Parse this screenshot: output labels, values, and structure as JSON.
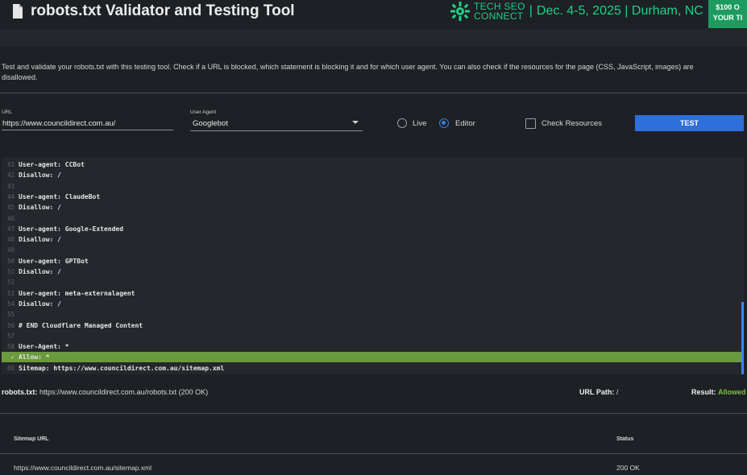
{
  "header": {
    "title": "robots.txt Validator and Testing Tool",
    "banner_brand_line1": "TECH SEO",
    "banner_brand_line2": "CONNECT",
    "banner_separator": "|",
    "banner_event": "Dec. 4-5, 2025 | Durham, NC",
    "promo_line1": "$100 O",
    "promo_line2": "YOUR TI"
  },
  "intro": "Test and validate your robots.txt with this testing tool. Check if a URL is blocked, which statement is blocking it and for which user agent. You can also check if the resources for the page (CSS, JavaScript, images) are disallowed.",
  "form": {
    "url_label": "URL",
    "url_value": "https://www.councildirect.com.au/",
    "ua_label": "User Agent",
    "ua_value": "Googlebot",
    "radio_live": "Live",
    "radio_editor": "Editor",
    "selected_mode": "Editor",
    "check_resources": "Check Resources",
    "check_resources_checked": false,
    "test_button": "TEST"
  },
  "editor": {
    "lines": [
      {
        "n": "41",
        "text": "User-agent: CCBot"
      },
      {
        "n": "42",
        "text": "Disallow: /"
      },
      {
        "n": "43",
        "text": ""
      },
      {
        "n": "44",
        "text": "User-agent: ClaudeBot"
      },
      {
        "n": "45",
        "text": "Disallow: /"
      },
      {
        "n": "46",
        "text": ""
      },
      {
        "n": "47",
        "text": "User-agent: Google-Extended"
      },
      {
        "n": "48",
        "text": "Disallow: /"
      },
      {
        "n": "49",
        "text": ""
      },
      {
        "n": "50",
        "text": "User-agent: GPTBot"
      },
      {
        "n": "51",
        "text": "Disallow: /"
      },
      {
        "n": "52",
        "text": ""
      },
      {
        "n": "53",
        "text": "User-agent: meta-externalagent"
      },
      {
        "n": "54",
        "text": "Disallow: /"
      },
      {
        "n": "55",
        "text": ""
      },
      {
        "n": "56",
        "text": "# END Cloudflare Managed Content"
      },
      {
        "n": "57",
        "text": ""
      },
      {
        "n": "58",
        "text": "User-Agent: *"
      },
      {
        "n": "✓",
        "text": "Allow: *"
      },
      {
        "n": "60",
        "text": "Sitemap: https://www.councildirect.com.au/sitemap.xml"
      }
    ],
    "highlighted_line": "Allow: *",
    "highlight_color": "#6b9a3e"
  },
  "result": {
    "robots_label": "robots.txt:",
    "robots_value": "https://www.councildirect.com.au/robots.txt (200 OK)",
    "url_path_label": "URL Path:",
    "url_path_value": "/",
    "result_label": "Result:",
    "result_value": "Allowed",
    "result_color": "#7bc143"
  },
  "sitemaps": {
    "col_url": "Sitemap URL",
    "col_status": "Status",
    "rows": [
      {
        "url": "https://www.councildirect.com.au/sitemap.xml",
        "status": "200 OK"
      }
    ]
  },
  "colors": {
    "accent_button": "#2f6fdc",
    "brand_green": "#1fd18a"
  }
}
